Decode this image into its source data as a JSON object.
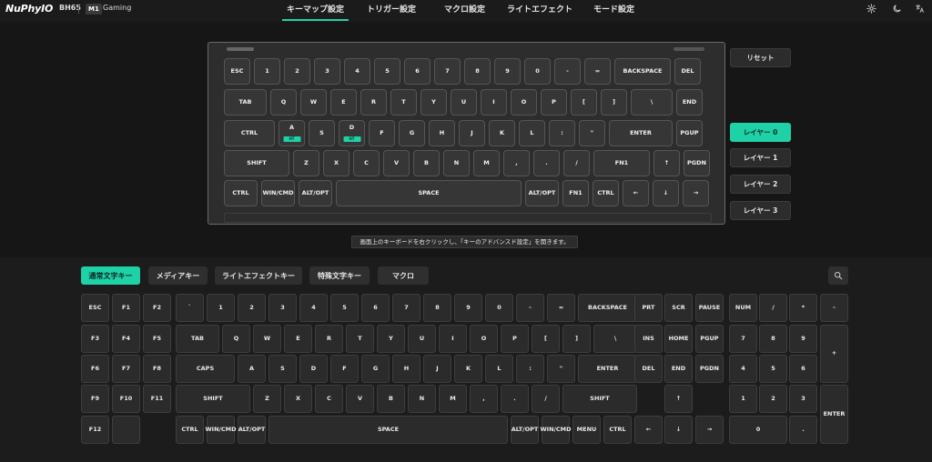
{
  "header": {
    "logo": "NuPhyIO",
    "model": "BH65",
    "profile_badge": "M1",
    "profile_name": "Gaming",
    "tabs": [
      "キーマップ設定",
      "トリガー設定",
      "マクロ設定",
      "ライトエフェクト",
      "モード設定"
    ],
    "active_tab": "キーマップ設定",
    "icons": [
      "gear-icon",
      "moon-icon",
      "translate-icon"
    ]
  },
  "keyboard": {
    "rows": [
      [
        "ESC",
        "1",
        "2",
        "3",
        "4",
        "5",
        "6",
        "7",
        "8",
        "9",
        "0",
        "-",
        "=",
        "BACKSPACE",
        "DEL"
      ],
      [
        "TAB",
        "Q",
        "W",
        "E",
        "R",
        "T",
        "Y",
        "U",
        "I",
        "O",
        "P",
        "[",
        "]",
        "\\",
        "END"
      ],
      [
        "CTRL",
        "A",
        "S",
        "D",
        "F",
        "G",
        "H",
        "J",
        "K",
        "L",
        ":",
        "\"",
        "ENTER",
        "PGUP"
      ],
      [
        "SHIFT",
        "Z",
        "X",
        "C",
        "V",
        "B",
        "N",
        "M",
        ",",
        ".",
        "/",
        "FN1",
        "↑",
        "PGDN"
      ],
      [
        "CTRL",
        "WIN/CMD",
        "ALT/OPT",
        "SPACE",
        "ALT/OPT",
        "FN1",
        "CTRL",
        "←",
        "↓",
        "→"
      ]
    ],
    "tap_hold_badge": "HT",
    "tap_hold_keys": [
      "A",
      "D"
    ]
  },
  "side": {
    "reset": "リセット",
    "layers": [
      "レイヤー 0",
      "レイヤー 1",
      "レイヤー 2",
      "レイヤー 3"
    ],
    "active_layer": 0
  },
  "hint": "画面上のキーボードを右クリックし、「キーのアドバンスド設定」を開きます。",
  "categories": {
    "items": [
      "通常文字キー",
      "メディアキー",
      "ライトエフェクトキー",
      "特殊文字キー",
      "マクロ"
    ],
    "active": 0
  },
  "picker": {
    "fkeys": [
      [
        "ESC",
        "F1",
        "F2"
      ],
      [
        "F3",
        "F4",
        "F5"
      ],
      [
        "F6",
        "F7",
        "F8"
      ],
      [
        "F9",
        "F10",
        "F11"
      ],
      [
        "F12",
        ""
      ]
    ],
    "main": [
      [
        "`",
        "1",
        "2",
        "3",
        "4",
        "5",
        "6",
        "7",
        "8",
        "9",
        "0",
        "-",
        "=",
        "BACKSPACE"
      ],
      [
        "TAB",
        "Q",
        "W",
        "E",
        "R",
        "T",
        "Y",
        "U",
        "I",
        "O",
        "P",
        "[",
        "]",
        "\\"
      ],
      [
        "CAPS",
        "A",
        "S",
        "D",
        "F",
        "G",
        "H",
        "J",
        "K",
        "L",
        ":",
        "\"",
        "ENTER"
      ],
      [
        "SHIFT",
        "Z",
        "X",
        "C",
        "V",
        "B",
        "N",
        "M",
        ",",
        ".",
        "/",
        "SHIFT"
      ],
      [
        "CTRL",
        "WIN/CMD",
        "ALT/OPT",
        "SPACE",
        "ALT/OPT",
        "WIN/CMD",
        "MENU",
        "CTRL"
      ]
    ],
    "nav": [
      [
        "PRT",
        "SCR",
        "PAUSE"
      ],
      [
        "INS",
        "HOME",
        "PGUP"
      ],
      [
        "DEL",
        "END",
        "PGDN"
      ],
      [
        "",
        "↑",
        ""
      ],
      [
        "←",
        "↓",
        "→"
      ]
    ],
    "numpad": [
      [
        "NUM",
        "/",
        "*",
        "-"
      ],
      [
        "7",
        "8",
        "9",
        "+"
      ],
      [
        "4",
        "5",
        "6"
      ],
      [
        "1",
        "2",
        "3",
        "ENTER"
      ],
      [
        "0",
        "."
      ]
    ]
  },
  "colors": {
    "accent": "#1fd1a6",
    "background": "#161616"
  }
}
